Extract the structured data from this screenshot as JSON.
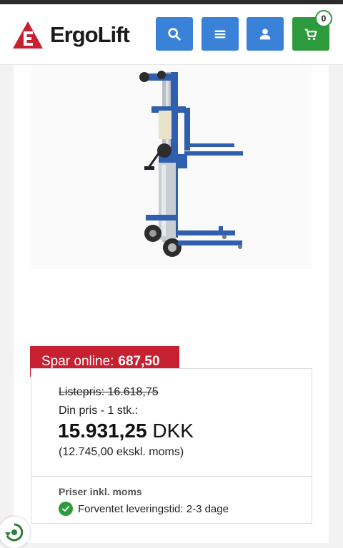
{
  "header": {
    "brand": "ErgoLift",
    "cart_count": "0",
    "colors": {
      "blue": "#3a82d8",
      "green": "#2e9a3e",
      "brand_red": "#c62031"
    },
    "icons": [
      "search-icon",
      "menu-icon",
      "user-icon",
      "cart-icon"
    ]
  },
  "product": {
    "image": "material-lift-image"
  },
  "price": {
    "savings_label": "Spar online:",
    "savings_value": "687,50",
    "list_price": "Listepris: 16.618,75",
    "your_price_label": "Din pris - 1 stk.:",
    "amount": "15.931,25",
    "currency": "DKK",
    "excl_vat": "(12.745,00 ekskl. moms)",
    "incl_vat_note": "Priser inkl. moms",
    "delivery": "Forventet leveringstid: 2-3 dage"
  }
}
